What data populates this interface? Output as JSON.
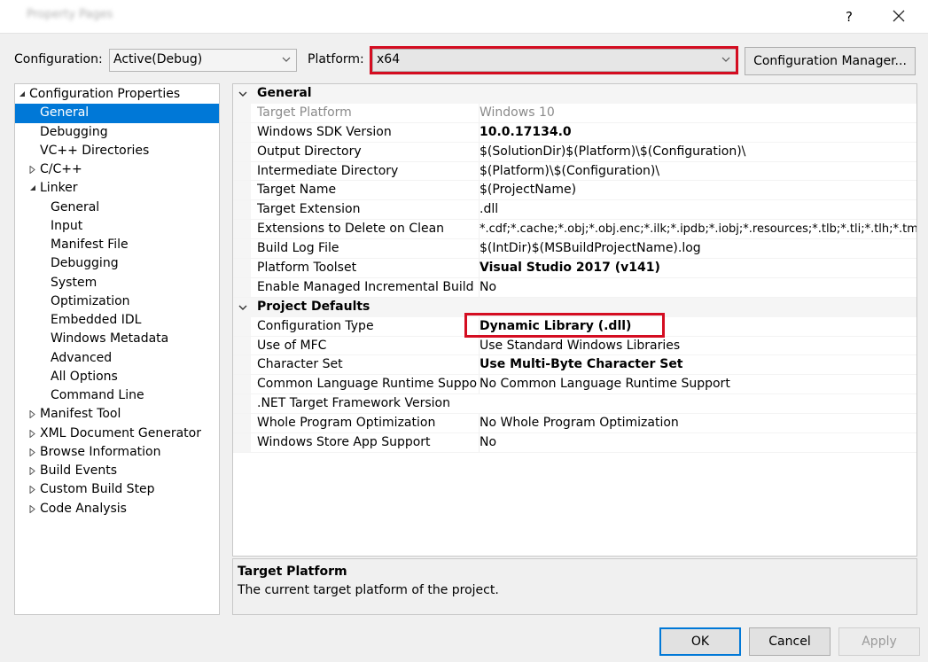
{
  "titlebar": {
    "title": "Property Pages",
    "help_label": "?",
    "close_icon": "close-icon"
  },
  "toolbar": {
    "configuration_label": "Configuration:",
    "configuration_value": "Active(Debug)",
    "platform_label": "Platform:",
    "platform_value": "x64",
    "config_manager_label": "Configuration Manager..."
  },
  "tree": {
    "items": [
      {
        "label": "Configuration Properties"
      },
      {
        "label": "General"
      },
      {
        "label": "Debugging"
      },
      {
        "label": "VC++ Directories"
      },
      {
        "label": "C/C++"
      },
      {
        "label": "Linker"
      },
      {
        "label": "General"
      },
      {
        "label": "Input"
      },
      {
        "label": "Manifest File"
      },
      {
        "label": "Debugging"
      },
      {
        "label": "System"
      },
      {
        "label": "Optimization"
      },
      {
        "label": "Embedded IDL"
      },
      {
        "label": "Windows Metadata"
      },
      {
        "label": "Advanced"
      },
      {
        "label": "All Options"
      },
      {
        "label": "Command Line"
      },
      {
        "label": "Manifest Tool"
      },
      {
        "label": "XML Document Generator"
      },
      {
        "label": "Browse Information"
      },
      {
        "label": "Build Events"
      },
      {
        "label": "Custom Build Step"
      },
      {
        "label": "Code Analysis"
      }
    ]
  },
  "grid": {
    "categories": [
      {
        "name": "General",
        "rows": [
          {
            "name": "Target Platform",
            "value": "Windows 10"
          },
          {
            "name": "Windows SDK Version",
            "value": "10.0.17134.0"
          },
          {
            "name": "Output Directory",
            "value": "$(SolutionDir)$(Platform)\\$(Configuration)\\"
          },
          {
            "name": "Intermediate Directory",
            "value": "$(Platform)\\$(Configuration)\\"
          },
          {
            "name": "Target Name",
            "value": "$(ProjectName)"
          },
          {
            "name": "Target Extension",
            "value": ".dll"
          },
          {
            "name": "Extensions to Delete on Clean",
            "value": "*.cdf;*.cache;*.obj;*.obj.enc;*.ilk;*.ipdb;*.iobj;*.resources;*.tlb;*.tli;*.tlh;*.tmp;*."
          },
          {
            "name": "Build Log File",
            "value": "$(IntDir)$(MSBuildProjectName).log"
          },
          {
            "name": "Platform Toolset",
            "value": "Visual Studio 2017 (v141)"
          },
          {
            "name": "Enable Managed Incremental Build",
            "value": "No"
          }
        ]
      },
      {
        "name": "Project Defaults",
        "rows": [
          {
            "name": "Configuration Type",
            "value": "Dynamic Library (.dll)"
          },
          {
            "name": "Use of MFC",
            "value": "Use Standard Windows Libraries"
          },
          {
            "name": "Character Set",
            "value": "Use Multi-Byte Character Set"
          },
          {
            "name": "Common Language Runtime Support",
            "value": "No Common Language Runtime Support"
          },
          {
            "name": ".NET Target Framework Version",
            "value": ""
          },
          {
            "name": "Whole Program Optimization",
            "value": "No Whole Program Optimization"
          },
          {
            "name": "Windows Store App Support",
            "value": "No"
          }
        ]
      }
    ]
  },
  "description": {
    "title": "Target Platform",
    "text": "The current target platform of the project."
  },
  "buttons": {
    "ok": "OK",
    "cancel": "Cancel",
    "apply": "Apply"
  },
  "colors": {
    "highlight_red": "#d40d21",
    "selection_blue": "#0078d7"
  }
}
